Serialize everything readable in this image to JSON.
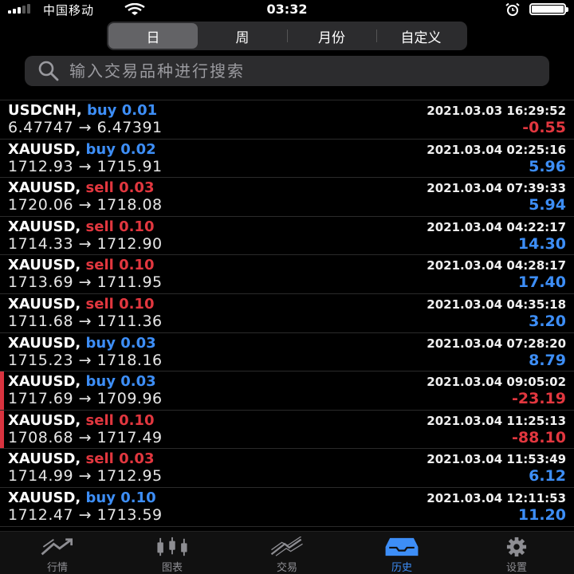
{
  "status_bar": {
    "carrier": "中国移动",
    "time": "03:32"
  },
  "segments": [
    {
      "label": "日",
      "active": true
    },
    {
      "label": "周",
      "active": false
    },
    {
      "label": "月份",
      "active": false
    },
    {
      "label": "自定义",
      "active": false
    }
  ],
  "search": {
    "placeholder": "输入交易品种进行搜索"
  },
  "deals": [
    {
      "symbol": "USDCNH,",
      "side": "buy",
      "volume": "0.01",
      "time": "2021.03.03 16:29:52",
      "prices": "6.47747 → 6.47391",
      "profit": "-0.55",
      "flagged": false
    },
    {
      "symbol": "XAUUSD,",
      "side": "buy",
      "volume": "0.02",
      "time": "2021.03.04 02:25:16",
      "prices": "1712.93 → 1715.91",
      "profit": "5.96",
      "flagged": false
    },
    {
      "symbol": "XAUUSD,",
      "side": "sell",
      "volume": "0.03",
      "time": "2021.03.04 07:39:33",
      "prices": "1720.06 → 1718.08",
      "profit": "5.94",
      "flagged": false
    },
    {
      "symbol": "XAUUSD,",
      "side": "sell",
      "volume": "0.10",
      "time": "2021.03.04 04:22:17",
      "prices": "1714.33 → 1712.90",
      "profit": "14.30",
      "flagged": false
    },
    {
      "symbol": "XAUUSD,",
      "side": "sell",
      "volume": "0.10",
      "time": "2021.03.04 04:28:17",
      "prices": "1713.69 → 1711.95",
      "profit": "17.40",
      "flagged": false
    },
    {
      "symbol": "XAUUSD,",
      "side": "sell",
      "volume": "0.10",
      "time": "2021.03.04 04:35:18",
      "prices": "1711.68 → 1711.36",
      "profit": "3.20",
      "flagged": false
    },
    {
      "symbol": "XAUUSD,",
      "side": "buy",
      "volume": "0.03",
      "time": "2021.03.04 07:28:20",
      "prices": "1715.23 → 1718.16",
      "profit": "8.79",
      "flagged": false
    },
    {
      "symbol": "XAUUSD,",
      "side": "buy",
      "volume": "0.03",
      "time": "2021.03.04 09:05:02",
      "prices": "1717.69 → 1709.96",
      "profit": "-23.19",
      "flagged": true
    },
    {
      "symbol": "XAUUSD,",
      "side": "sell",
      "volume": "0.10",
      "time": "2021.03.04 11:25:13",
      "prices": "1708.68 → 1717.49",
      "profit": "-88.10",
      "flagged": true
    },
    {
      "symbol": "XAUUSD,",
      "side": "sell",
      "volume": "0.03",
      "time": "2021.03.04 11:53:49",
      "prices": "1714.99 → 1712.95",
      "profit": "6.12",
      "flagged": false
    },
    {
      "symbol": "XAUUSD,",
      "side": "buy",
      "volume": "0.10",
      "time": "2021.03.04 12:11:53",
      "prices": "1712.47 → 1713.59",
      "profit": "11.20",
      "flagged": false
    }
  ],
  "tabs": [
    {
      "label": "行情",
      "icon": "quotes-icon",
      "active": false
    },
    {
      "label": "图表",
      "icon": "chart-candles-icon",
      "active": false
    },
    {
      "label": "交易",
      "icon": "trade-icon",
      "active": false
    },
    {
      "label": "历史",
      "icon": "history-inbox-icon",
      "active": true
    },
    {
      "label": "设置",
      "icon": "gear-icon",
      "active": false
    }
  ],
  "colors": {
    "buy": "#3d8ef7",
    "sell": "#e2373f",
    "background": "#000000"
  }
}
